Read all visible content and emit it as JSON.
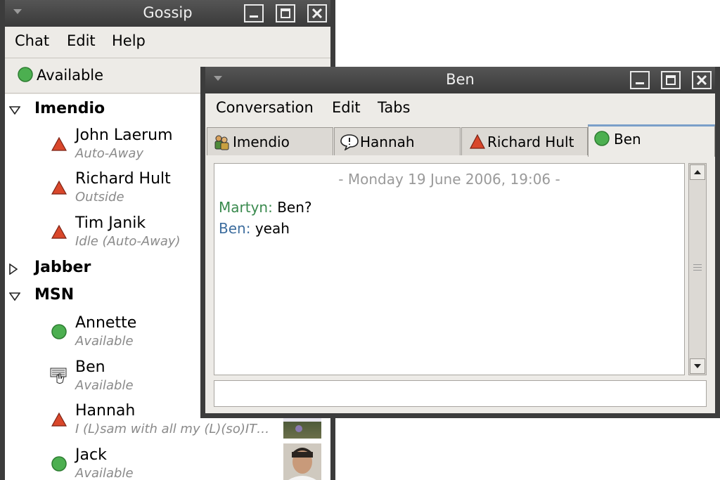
{
  "gossip": {
    "title": "Gossip",
    "menu": [
      "Chat",
      "Edit",
      "Help"
    ],
    "status": "Available",
    "groups": [
      {
        "name": "Imendio",
        "expanded": true
      },
      {
        "name": "Jabber",
        "expanded": false
      },
      {
        "name": "MSN",
        "expanded": true
      }
    ],
    "contacts": [
      {
        "name": "John Laerum",
        "status": "Auto-Away",
        "icon": "away-triangle-icon"
      },
      {
        "name": "Richard Hult",
        "status": "Outside",
        "icon": "away-triangle-icon"
      },
      {
        "name": "Tim Janik",
        "status": "Idle (Auto-Away)",
        "icon": "away-triangle-icon"
      },
      {
        "name": "Annette",
        "status": "Available",
        "icon": "available-dot-icon"
      },
      {
        "name": "Ben",
        "status": "Available",
        "icon": "typing-keyboard-icon"
      },
      {
        "name": "Hannah",
        "status": "I (L)sam with all my (L)(so)IT…",
        "icon": "away-triangle-icon"
      },
      {
        "name": "Jack",
        "status": "Available",
        "icon": "available-dot-icon"
      }
    ]
  },
  "chat": {
    "title": "Ben",
    "menu": [
      "Conversation",
      "Edit",
      "Tabs"
    ],
    "tabs": [
      {
        "label": "Imendio",
        "icon": "group-chat-icon"
      },
      {
        "label": "Hannah",
        "icon": "message-bubble-icon"
      },
      {
        "label": "Richard Hult",
        "icon": "away-triangle-icon"
      },
      {
        "label": "Ben",
        "icon": "available-dot-icon",
        "active": true
      }
    ],
    "date_line": "- Monday 19 June 2006, 19:06 -",
    "messages": [
      {
        "sender": "Martyn:",
        "text": "Ben?"
      },
      {
        "sender": "Ben:",
        "text": "yeah"
      }
    ],
    "input_value": ""
  },
  "colors": {
    "available": "#4caf50",
    "away": "#d9472b",
    "sender_self": "#3a8a4e",
    "sender_other": "#3d6d9e",
    "titlebar": "#444444"
  }
}
